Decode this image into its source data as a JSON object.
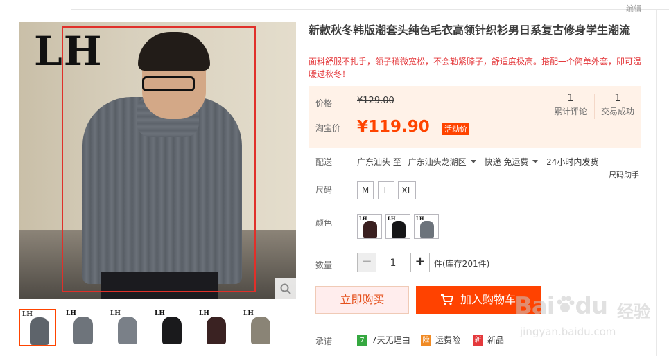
{
  "header": {
    "edit_label": "编辑"
  },
  "gallery": {
    "main_logo": "LH",
    "thumb_logo": "LH",
    "thumbs": [
      {
        "name": "thumb-1"
      },
      {
        "name": "thumb-2"
      },
      {
        "name": "thumb-3"
      },
      {
        "name": "thumb-4"
      },
      {
        "name": "thumb-5"
      },
      {
        "name": "thumb-6"
      }
    ]
  },
  "product": {
    "title": "新款秋冬韩版潮套头纯色毛衣高领针织衫男日系复古修身学生潮流",
    "subtitle": "面料舒服不扎手，领子稍微宽松，不会勒紧脖子，舒适度极高。搭配一个简单外套，即可温暖过秋冬！"
  },
  "price": {
    "price_label": "价格",
    "original": "¥129.00",
    "promo_label": "淘宝价",
    "promo_price": "¥119.90",
    "promo_tag": "活动价"
  },
  "stats": {
    "reviews_count": "1",
    "reviews_label": "累计评论",
    "deals_count": "1",
    "deals_label": "交易成功"
  },
  "shipping": {
    "label": "配送",
    "from": "广东汕头 至",
    "to": "广东汕头龙湖区",
    "method": "快递 免运费",
    "dispatch": "24小时内发货",
    "size_helper": "尺码助手"
  },
  "size": {
    "label": "尺码",
    "options": [
      "M",
      "L",
      "XL"
    ]
  },
  "color": {
    "label": "颜色",
    "logo": "LH"
  },
  "quantity": {
    "label": "数量",
    "minus": "−",
    "value": "1",
    "plus": "+",
    "stock_text": "件(库存201件)"
  },
  "actions": {
    "buy_now": "立即购买",
    "add_to_cart": "加入购物车"
  },
  "promises": {
    "label": "承诺",
    "items": [
      {
        "icon": "7",
        "text": "7天无理由"
      },
      {
        "icon": "险",
        "text": "运费险"
      },
      {
        "icon": "新",
        "text": "新品"
      }
    ]
  },
  "watermark": {
    "brand": "Bai",
    "brand2": "du",
    "cn": "经验",
    "url": "jingyan.baidu.com"
  },
  "colors": {
    "accent": "#ff4400",
    "price_bg": "#fff2e8",
    "promise_green": "#35a840",
    "promise_orange": "#f08a24",
    "promise_red": "#e4393c"
  }
}
